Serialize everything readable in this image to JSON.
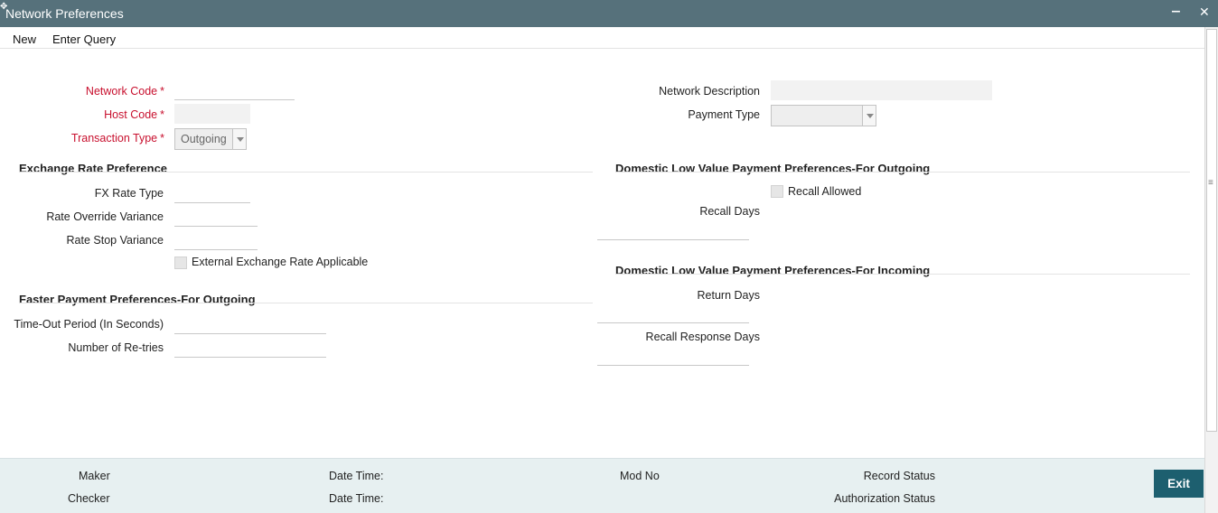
{
  "window": {
    "title": "Network Preferences"
  },
  "menu": {
    "new": "New",
    "enter_query": "Enter Query"
  },
  "form": {
    "network_code": {
      "label": "Network Code",
      "value": ""
    },
    "host_code": {
      "label": "Host Code",
      "value": ""
    },
    "transaction_type": {
      "label": "Transaction Type",
      "value": "Outgoing"
    },
    "network_description": {
      "label": "Network Description",
      "value": ""
    },
    "payment_type": {
      "label": "Payment Type",
      "value": ""
    }
  },
  "exchange_rate": {
    "title": "Exchange Rate Preference",
    "fx_rate_type": "FX Rate Type",
    "rate_override_variance": "Rate Override Variance",
    "rate_stop_variance": "Rate Stop Variance",
    "external_rate": "External Exchange Rate Applicable"
  },
  "faster_payment": {
    "title": "Faster Payment Preferences-For Outgoing",
    "timeout": "Time-Out Period (In Seconds)",
    "retries": "Number of Re-tries"
  },
  "dlv_outgoing": {
    "title": "Domestic Low Value Payment Preferences-For Outgoing",
    "recall_allowed": "Recall Allowed",
    "recall_days": "Recall Days"
  },
  "dlv_incoming": {
    "title": "Domestic Low Value Payment Preferences-For Incoming",
    "return_days": "Return Days",
    "recall_response_days": "Recall Response Days"
  },
  "footer": {
    "maker": "Maker",
    "checker": "Checker",
    "date_time_1": "Date Time:",
    "date_time_2": "Date Time:",
    "mod_no": "Mod No",
    "record_status": "Record Status",
    "authorization_status": "Authorization Status",
    "exit": "Exit"
  },
  "colors": {
    "titlebar": "#56717b",
    "required": "#c8102e",
    "footer": "#e7f0f1",
    "exit_button": "#1d5f6f"
  },
  "icons": [
    "minimize-icon",
    "close-icon",
    "dropdown-arrow-icon",
    "checkbox-icon"
  ]
}
